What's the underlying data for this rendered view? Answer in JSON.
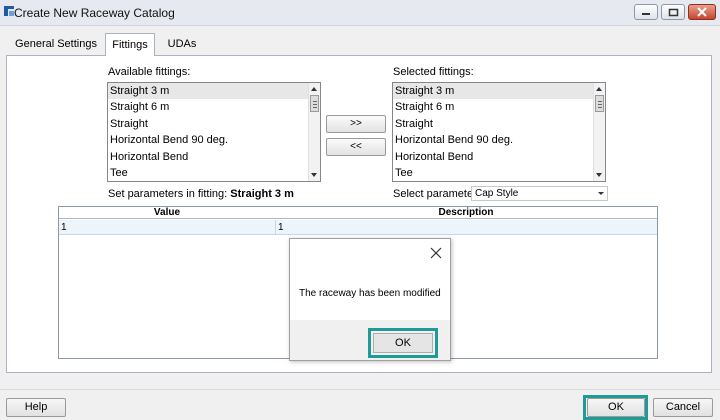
{
  "window": {
    "title": "Create New Raceway Catalog",
    "controls": [
      "minimize-icon",
      "maximize-icon",
      "close-icon"
    ]
  },
  "tabs": [
    {
      "label": "General Settings",
      "active": false
    },
    {
      "label": "Fittings",
      "active": true
    },
    {
      "label": "UDAs",
      "active": false
    }
  ],
  "fittings": {
    "available_label": "Available fittings:",
    "available_items": [
      "Straight 3 m",
      "Straight 6 m",
      "Straight",
      "Horizontal Bend 90 deg.",
      "Horizontal Bend",
      "Tee"
    ],
    "available_selected": "Straight 3 m",
    "selected_label": "Selected fittings:",
    "selected_items": [
      "Straight 3 m",
      "Straight 6 m",
      "Straight",
      "Horizontal Bend 90 deg.",
      "Horizontal Bend",
      "Tee"
    ],
    "selected_selected": "Straight 3 m",
    "add_button": ">>",
    "remove_button": "<<"
  },
  "params": {
    "set_in_prefix": "Set parameters in fitting:",
    "set_in_value": "Straight 3 m",
    "select_label": "Select parameter:",
    "select_value": "Cap Style"
  },
  "grid": {
    "columns": [
      "Value",
      "Description"
    ],
    "rows": [
      {
        "value": "1",
        "description": "1"
      }
    ]
  },
  "dialog": {
    "message": "The raceway has been modified",
    "ok_label": "OK",
    "highlight_color": "#1f9b97"
  },
  "footer": {
    "help_label": "Help",
    "ok_label": "OK",
    "cancel_label": "Cancel"
  }
}
